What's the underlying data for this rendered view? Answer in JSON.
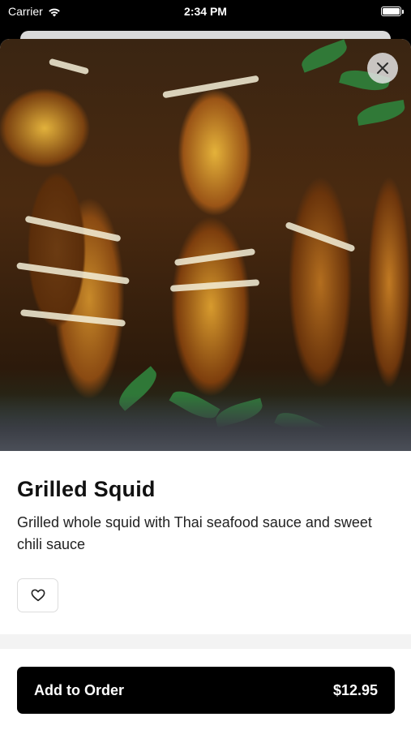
{
  "status_bar": {
    "carrier": "Carrier",
    "time": "2:34 PM",
    "wifi_icon": "wifi-icon",
    "battery_icon": "battery-icon"
  },
  "hero": {
    "image_subject": "grilled squid on banana leaves",
    "close_icon": "close-icon"
  },
  "item": {
    "title": "Grilled Squid",
    "description": "Grilled whole squid with Thai seafood sauce and sweet chili sauce",
    "favorite_icon": "heart-outline-icon"
  },
  "order": {
    "label": "Add to Order",
    "price": "$12.95"
  },
  "colors": {
    "button_bg": "#000000",
    "button_text": "#ffffff",
    "title_text": "#111111"
  }
}
